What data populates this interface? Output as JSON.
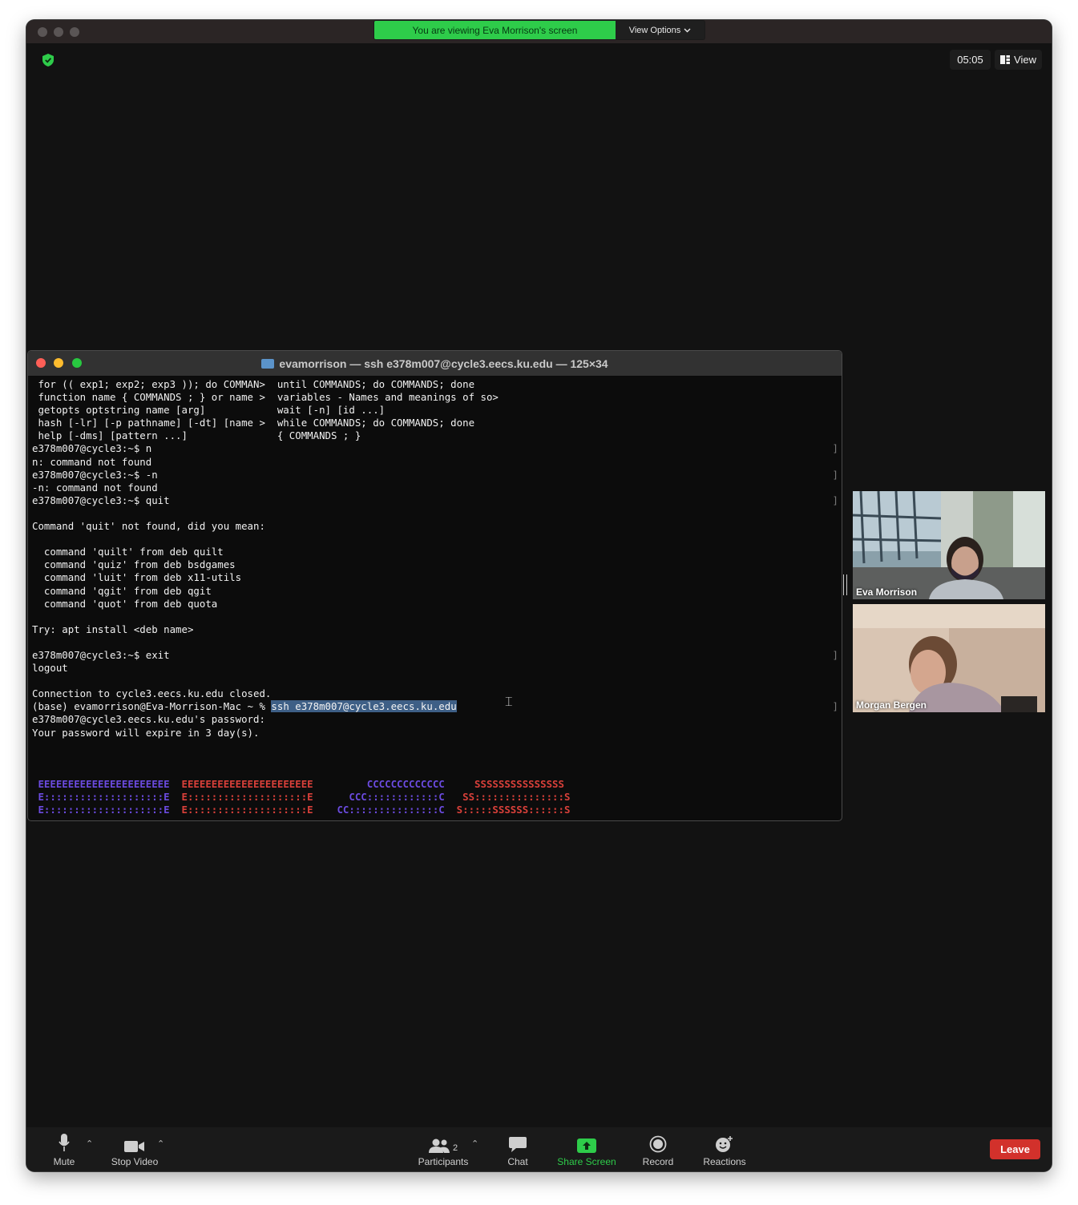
{
  "banner": {
    "viewing_text": "You are viewing Eva Morrison's screen",
    "view_options_label": "View Options"
  },
  "meeting": {
    "timer": "05:05",
    "view_label": "View"
  },
  "terminal": {
    "title": "evamorrison — ssh e378m007@cycle3.eecs.ku.edu — 125×34",
    "lines": [
      " for (( exp1; exp2; exp3 )); do COMMAN>  until COMMANDS; do COMMANDS; done",
      " function name { COMMANDS ; } or name >  variables - Names and meanings of so>",
      " getopts optstring name [arg]            wait [-n] [id ...]",
      " hash [-lr] [-p pathname] [-dt] [name >  while COMMANDS; do COMMANDS; done",
      " help [-dms] [pattern ...]               { COMMANDS ; }",
      "e378m007@cycle3:~$ n",
      "n: command not found",
      "e378m007@cycle3:~$ -n",
      "-n: command not found",
      "e378m007@cycle3:~$ quit",
      "",
      "Command 'quit' not found, did you mean:",
      "",
      "  command 'quilt' from deb quilt",
      "  command 'quiz' from deb bsdgames",
      "  command 'luit' from deb x11-utils",
      "  command 'qgit' from deb qgit",
      "  command 'quot' from deb quota",
      "",
      "Try: apt install <deb name>",
      "",
      "e378m007@cycle3:~$ exit",
      "logout",
      "",
      "Connection to cycle3.eecs.ku.edu closed."
    ],
    "prompt_prefix": "(base) evamorrison@Eva-Morrison-Mac ~ % ",
    "selected_command": "ssh e378m007@cycle3.eecs.ku.edu",
    "post_lines": [
      "e378m007@cycle3.eecs.ku.edu's password:",
      "Your password will expire in 3 day(s)."
    ],
    "ascii_banner": [
      [
        " EEEEEEEEEEEEEEEEEEEEEE",
        "  EEEEEEEEEEEEEEEEEEEEEE",
        "         CCCCCCCCCCCCC",
        "     SSSSSSSSSSSSSSS"
      ],
      [
        " E::::::::::::::::::::E",
        "  E::::::::::::::::::::E",
        "      CCC::::::::::::C",
        "   SS:::::::::::::::S"
      ],
      [
        " E::::::::::::::::::::E",
        "  E::::::::::::::::::::E",
        "    CC:::::::::::::::C",
        "  S:::::SSSSSS::::::S"
      ]
    ]
  },
  "participants": [
    {
      "name": "Eva Morrison"
    },
    {
      "name": "Morgan Bergen"
    }
  ],
  "toolbar": {
    "mute": "Mute",
    "stop_video": "Stop Video",
    "participants": "Participants",
    "participant_count": "2",
    "chat": "Chat",
    "share_screen": "Share Screen",
    "record": "Record",
    "reactions": "Reactions",
    "leave": "Leave"
  },
  "colors": {
    "share_green": "#2ecc4a",
    "leave_red": "#d2312b",
    "banner_purple": "#6b4be0",
    "banner_red": "#d9403a",
    "selection_blue": "#3e5f86"
  }
}
